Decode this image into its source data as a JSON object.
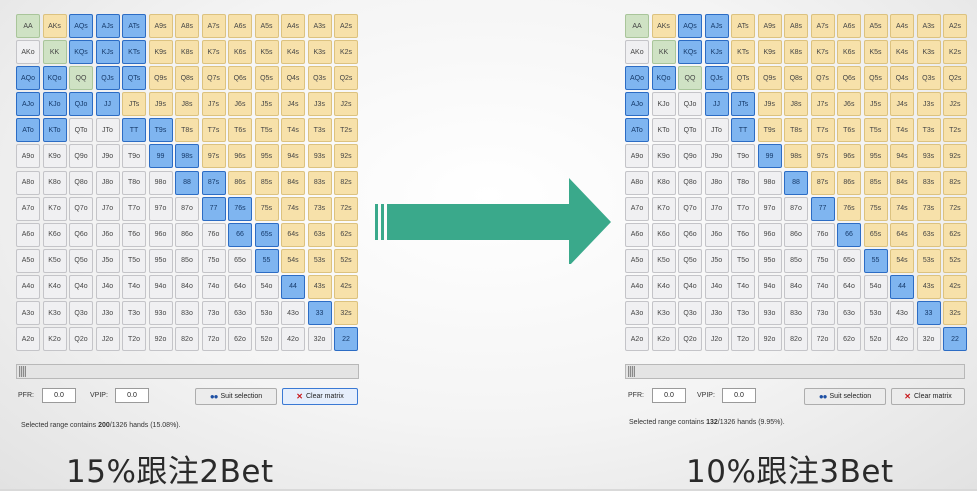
{
  "ranks": [
    "A",
    "K",
    "Q",
    "J",
    "T",
    "9",
    "8",
    "7",
    "6",
    "5",
    "4",
    "3",
    "2"
  ],
  "colors": {
    "pair": "#cfe2c4",
    "suited": "#f7e1aa",
    "offsuit": "#f0f0f2",
    "selected": "#7fb5f0",
    "selected_border": "#2c6cc4",
    "arrow": "#3aa98b"
  },
  "panels": [
    {
      "selected_hands": [
        "AQs",
        "AJs",
        "ATs",
        "KQs",
        "KJs",
        "KTs",
        "AQo",
        "KQo",
        "QJs",
        "QTs",
        "AJo",
        "KJo",
        "QJo",
        "JJ",
        "ATo",
        "KTo",
        "TT",
        "T9s",
        "99",
        "98s",
        "88",
        "87s",
        "77",
        "76s",
        "66",
        "65s",
        "55",
        "44",
        "33",
        "22"
      ],
      "pfr_label": "PFR:",
      "pfr_value": "0.0",
      "vpip_label": "VPIP:",
      "vpip_value": "0.0",
      "suit_button": "Suit selection",
      "clear_button": "Clear matrix",
      "status_prefix": "Selected range contains ",
      "status_count": "200",
      "status_suffix": "/1326 hands (15.08%).",
      "caption": "15%跟注2Bet"
    },
    {
      "selected_hands": [
        "AQs",
        "AJs",
        "KQs",
        "KJs",
        "AQo",
        "KQo",
        "QJs",
        "AJo",
        "JJ",
        "JTs",
        "ATo",
        "TT",
        "99",
        "88",
        "77",
        "66",
        "55",
        "44",
        "33",
        "22"
      ],
      "pfr_label": "PFR:",
      "pfr_value": "0.0",
      "vpip_label": "VPIP:",
      "vpip_value": "0.0",
      "suit_button": "Suit selection",
      "clear_button": "Clear matrix",
      "status_prefix": "Selected range contains ",
      "status_count": "132",
      "status_suffix": "/1326 hands (9.95%).",
      "caption": "10%跟注3Bet"
    }
  ],
  "icons": {
    "suit": "suit-selection-icon",
    "clear": "clear-x-icon",
    "arrow": "right-arrow-icon"
  }
}
